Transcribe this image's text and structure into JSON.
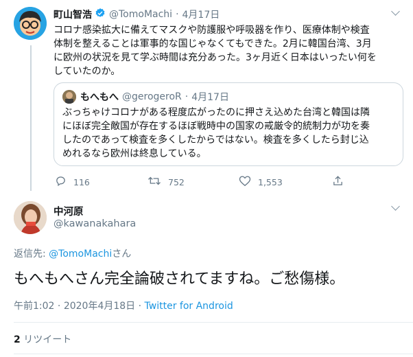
{
  "parent_tweet": {
    "name": "町山智浩",
    "handle": "@TomoMachi",
    "date": "4月17日",
    "lines": [
      "コロナ感染拡大に備えてマスクや防護服や呼吸器を作り、医療体制や検査",
      "体制を整えることは軍事的な国じゃなくてもできた。2月に韓国台湾、3月",
      "に欧州の状況を見て学ぶ時間は充分あった。3ヶ月近く日本はいったい何を",
      "していたのか。"
    ],
    "quoted": {
      "name": "もへもへ",
      "handle": "@gerogeroR",
      "date": "4月17日",
      "lines": [
        "ぶっちゃけコロナがある程度広がったのに押さえ込めた台湾と韓国は隣",
        "にほぼ完全敵国が存在するほぼ戦時中の国家の戒厳令的統制力が功を奏",
        "したのであって検査を多くしたからではない。検査を多くしたら封じ込",
        "めれるなら欧州は終息している。"
      ]
    },
    "actions": {
      "replies": "116",
      "retweets": "752",
      "likes": "1,553"
    }
  },
  "main_tweet": {
    "name": "中河原",
    "handle": "@kawanakahara",
    "reply_prefix": "返信先: ",
    "reply_target": "@TomoMachi",
    "reply_suffix": "さん",
    "text": "もへもへさん完全論破されてますね。ご愁傷様。",
    "time": "午前1:02",
    "sep": " · ",
    "date": "2020年4月18日",
    "client": "Twitter for Android",
    "retweet_count": "2",
    "retweet_label": " リツイート"
  },
  "colors": {
    "accent": "#1b95e0",
    "muted": "#657786",
    "border": "#e6ecf0"
  }
}
